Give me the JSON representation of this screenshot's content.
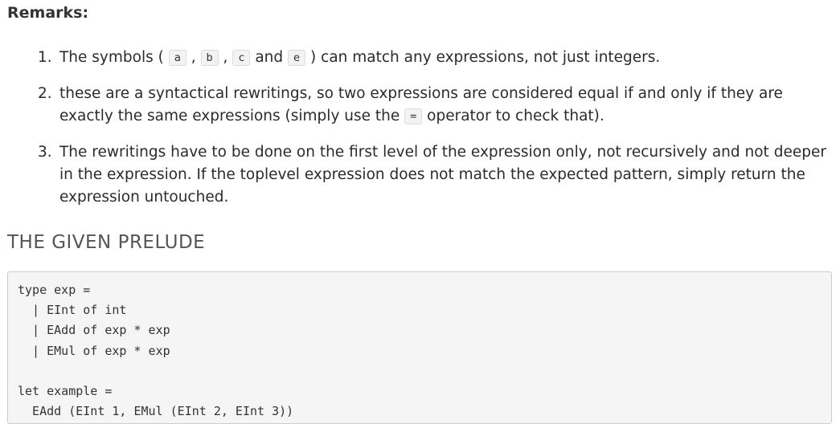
{
  "remarks": {
    "heading": "Remarks:",
    "items": [
      {
        "num": "1.",
        "parts": [
          {
            "t": "text",
            "v": "The symbols ( "
          },
          {
            "t": "code",
            "v": "a"
          },
          {
            "t": "text",
            "v": " , "
          },
          {
            "t": "code",
            "v": "b"
          },
          {
            "t": "text",
            "v": " , "
          },
          {
            "t": "code",
            "v": "c"
          },
          {
            "t": "text",
            "v": " and "
          },
          {
            "t": "code",
            "v": "e"
          },
          {
            "t": "text",
            "v": " ) can match any expressions, not just integers."
          }
        ]
      },
      {
        "num": "2.",
        "parts": [
          {
            "t": "text",
            "v": "these are a syntactical rewritings, so two expressions are considered equal if and only if they are exactly the same expressions (simply use the "
          },
          {
            "t": "code",
            "v": "="
          },
          {
            "t": "text",
            "v": " operator to check that)."
          }
        ]
      },
      {
        "num": "3.",
        "parts": [
          {
            "t": "text",
            "v": "The rewritings have to be done on the first level of the expression only, not recursively and not deeper in the expression. If the toplevel expression does not match the expected pattern, simply return the expression untouched."
          }
        ]
      }
    ]
  },
  "prelude": {
    "title": "THE GIVEN PRELUDE",
    "code_lines": [
      "type exp =",
      "  | EInt of int",
      "  | EAdd of exp * exp",
      "  | EMul of exp * exp",
      "",
      "let example =",
      "  EAdd (EInt 1, EMul (EInt 2, EInt 3))"
    ]
  }
}
